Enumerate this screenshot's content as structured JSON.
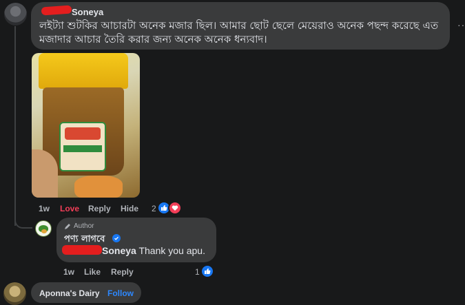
{
  "comment": {
    "author": "Soneya",
    "text": "লইট্যা শুটকির আচারটা অনেক মজার ছিল। আমার ছোট ছেলে মেয়েরাও অনেক পছন্দ করেছে এত মজাদার আচার তৈরি করার জন্য অনেক অনেক ধন্যবাদ।",
    "more": "···",
    "photo_alt": "Jar of pickle with yellow lid",
    "actions": {
      "time": "1w",
      "love": "Love",
      "reply": "Reply",
      "hide": "Hide"
    },
    "reaction_count": "2"
  },
  "reply": {
    "badge": "Author",
    "author": "পণ্য লাগবে",
    "mention": "Soneya",
    "text": " Thank you apu.",
    "actions": {
      "time": "1w",
      "like": "Like",
      "reply": "Reply"
    },
    "reaction_count": "1"
  },
  "next_comment": {
    "author": "Aponna's Dairy",
    "follow": "Follow"
  },
  "colors": {
    "background": "#18191a",
    "bubble": "#3a3b3c",
    "love": "#f33e58",
    "like_blue": "#1877f2",
    "follow_blue": "#2d88ff"
  }
}
